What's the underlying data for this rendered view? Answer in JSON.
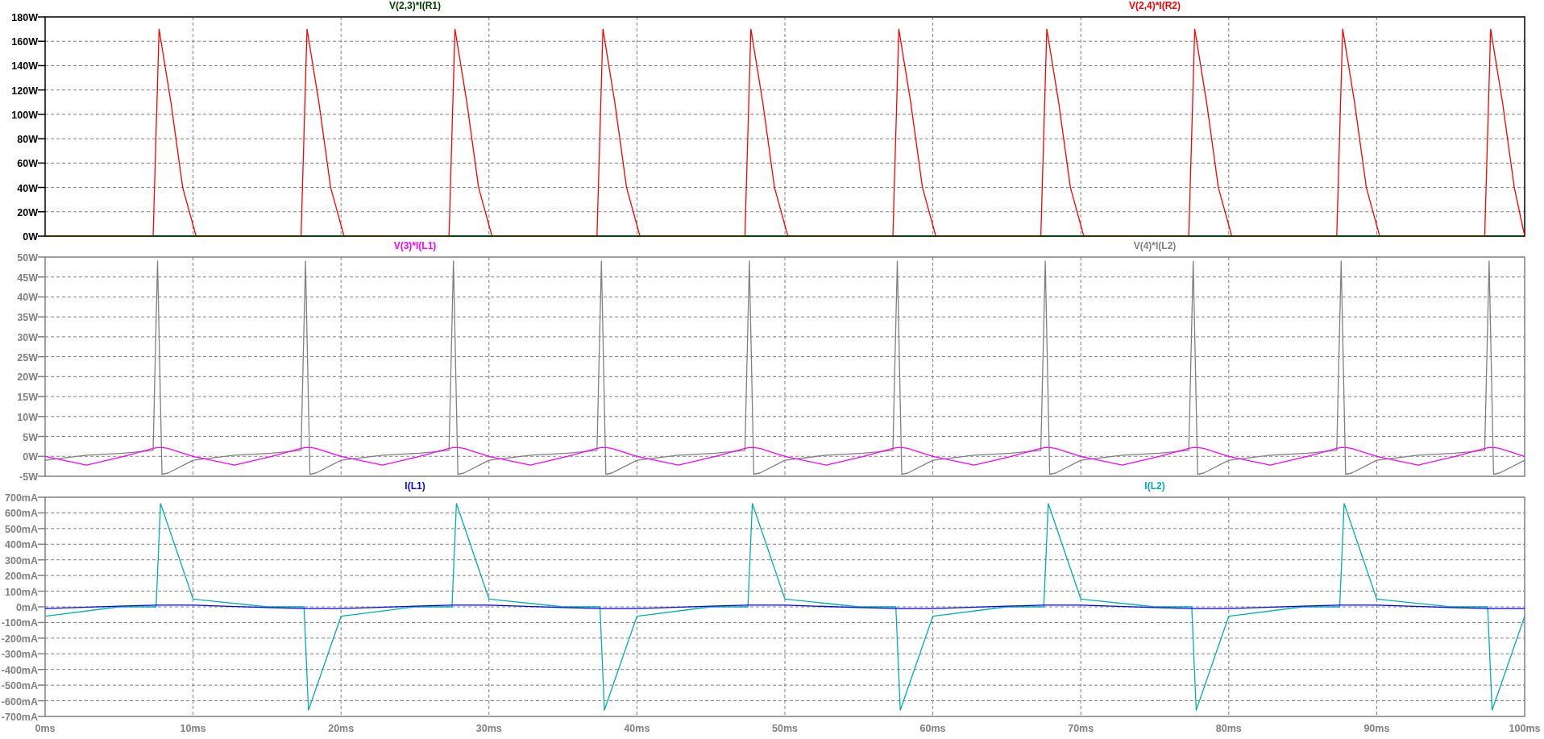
{
  "panes": [
    {
      "selected": true,
      "chart_data": {
        "type": "line",
        "xlim": [
          0,
          100
        ],
        "ylim": [
          0,
          180
        ],
        "x": [
          0,
          7.3,
          7.7,
          8.5,
          9.3,
          10.2,
          17.3,
          17.7,
          18.5,
          19.3,
          20.2,
          27.3,
          27.7,
          28.5,
          29.3,
          30.2,
          37.3,
          37.7,
          38.5,
          39.3,
          40.2,
          47.3,
          47.7,
          48.5,
          49.3,
          50.2,
          57.3,
          57.7,
          58.5,
          59.3,
          60.2,
          67.3,
          67.7,
          68.5,
          69.3,
          70.2,
          77.3,
          77.7,
          78.5,
          79.3,
          80.2,
          87.3,
          87.7,
          88.5,
          89.3,
          90.2,
          97.3,
          97.7,
          98.5,
          99.3,
          100
        ],
        "series": [
          {
            "name": "V(2,3)*I(R1)",
            "color": "#004000",
            "values": [
              0,
              0,
              0,
              0,
              0,
              0,
              0,
              0,
              0,
              0,
              0,
              0,
              0,
              0,
              0,
              0,
              0,
              0,
              0,
              0,
              0,
              0,
              0,
              0,
              0,
              0,
              0,
              0,
              0,
              0,
              0,
              0,
              0,
              0,
              0,
              0,
              0,
              0,
              0,
              0,
              0,
              0,
              0,
              0,
              0,
              0,
              0,
              0,
              0,
              0,
              0
            ]
          },
          {
            "name": "V(2,4)*I(R2)",
            "color": "#ff0000",
            "values": [
              0,
              0,
              170,
              110,
              40,
              0,
              0,
              170,
              110,
              40,
              0,
              0,
              170,
              110,
              40,
              0,
              0,
              170,
              110,
              40,
              0,
              0,
              170,
              110,
              40,
              0,
              0,
              170,
              110,
              40,
              0,
              0,
              170,
              110,
              40,
              0,
              0,
              170,
              110,
              40,
              0,
              0,
              170,
              110,
              40,
              0,
              0,
              170,
              110,
              40,
              0
            ]
          }
        ],
        "grid": true,
        "yticks": [
          {
            "value": 0,
            "label": "0W"
          },
          {
            "value": 20,
            "label": "20W"
          },
          {
            "value": 40,
            "label": "40W"
          },
          {
            "value": 60,
            "label": "60W"
          },
          {
            "value": 80,
            "label": "80W"
          },
          {
            "value": 100,
            "label": "100W"
          },
          {
            "value": 120,
            "label": "120W"
          },
          {
            "value": 140,
            "label": "140W"
          },
          {
            "value": 160,
            "label": "160W"
          },
          {
            "value": 180,
            "label": "180W"
          }
        ]
      }
    },
    {
      "selected": false,
      "chart_data": {
        "type": "line",
        "xlim": [
          0,
          100
        ],
        "ylim": [
          -5,
          50
        ],
        "x": [
          0,
          2.8,
          5.3,
          7.3,
          7.6,
          7.9,
          8.3,
          10,
          12.8,
          15.3,
          17.3,
          17.6,
          17.9,
          18.3,
          20,
          22.8,
          25.3,
          27.3,
          27.6,
          27.9,
          28.3,
          30,
          32.8,
          35.3,
          37.3,
          37.6,
          37.9,
          38.3,
          40,
          42.8,
          45.3,
          47.3,
          47.6,
          47.9,
          48.3,
          50,
          52.8,
          55.3,
          57.3,
          57.6,
          57.9,
          58.3,
          60,
          62.8,
          65.3,
          67.3,
          67.6,
          67.9,
          68.3,
          70,
          72.8,
          75.3,
          77.3,
          77.6,
          77.9,
          78.3,
          80,
          82.8,
          85.3,
          87.3,
          87.6,
          87.9,
          88.3,
          90,
          92.8,
          95.3,
          97.3,
          97.6,
          97.9,
          98.3,
          100
        ],
        "series": [
          {
            "name": "V(3)*I(L1)",
            "color": "#ff00ff",
            "values": [
              0,
              -2.2,
              0,
              2,
              2.2,
              2.2,
              2,
              0,
              -2.2,
              0,
              2,
              2.2,
              2.2,
              2,
              0,
              -2.2,
              0,
              2,
              2.2,
              2.2,
              2,
              0,
              -2.2,
              0,
              2,
              2.2,
              2.2,
              2,
              0,
              -2.2,
              0,
              2,
              2.2,
              2.2,
              2,
              0,
              -2.2,
              0,
              2,
              2.2,
              2.2,
              2,
              0,
              -2.2,
              0,
              2,
              2.2,
              2.2,
              2,
              0,
              -2.2,
              0,
              2,
              2.2,
              2.2,
              2,
              0,
              -2.2,
              0,
              2,
              2.2,
              2.2,
              2,
              0,
              -2.2,
              0,
              2,
              2.2,
              2.2,
              2,
              0
            ]
          },
          {
            "name": "V(4)*I(L2)",
            "color": "#808080",
            "values": [
              -1,
              0.3,
              0.8,
              1.5,
              49,
              -4.5,
              -4.2,
              -1,
              0.3,
              0.8,
              1.5,
              49,
              -4.5,
              -4.2,
              -1,
              0.3,
              0.8,
              1.5,
              49,
              -4.5,
              -4.2,
              -1,
              0.3,
              0.8,
              1.5,
              49,
              -4.5,
              -4.2,
              -1,
              0.3,
              0.8,
              1.5,
              49,
              -4.5,
              -4.2,
              -1,
              0.3,
              0.8,
              1.5,
              49,
              -4.5,
              -4.2,
              -1,
              0.3,
              0.8,
              1.5,
              49,
              -4.5,
              -4.2,
              -1,
              0.3,
              0.8,
              1.5,
              49,
              -4.5,
              -4.2,
              -1,
              0.3,
              0.8,
              1.5,
              49,
              -4.5,
              -4.2,
              -1,
              0.3,
              0.8,
              1.5,
              49,
              -4.5,
              -4.2,
              -1
            ]
          }
        ],
        "grid": true,
        "yticks": [
          {
            "value": -5,
            "label": "-5W"
          },
          {
            "value": 0,
            "label": "0W"
          },
          {
            "value": 5,
            "label": "5W"
          },
          {
            "value": 10,
            "label": "10W"
          },
          {
            "value": 15,
            "label": "15W"
          },
          {
            "value": 20,
            "label": "20W"
          },
          {
            "value": 25,
            "label": "25W"
          },
          {
            "value": 30,
            "label": "30W"
          },
          {
            "value": 35,
            "label": "35W"
          },
          {
            "value": 40,
            "label": "40W"
          },
          {
            "value": 45,
            "label": "45W"
          },
          {
            "value": 50,
            "label": "50W"
          }
        ]
      }
    },
    {
      "selected": false,
      "chart_data": {
        "type": "line",
        "xlim": [
          0,
          100
        ],
        "ylim": [
          -700,
          700
        ],
        "x": [
          0,
          5,
          7.5,
          7.8,
          10,
          15,
          17.5,
          17.8,
          20,
          25,
          27.5,
          27.8,
          30,
          35,
          37.5,
          37.8,
          40,
          45,
          47.5,
          47.8,
          50,
          55,
          57.5,
          57.8,
          60,
          65,
          67.5,
          67.8,
          70,
          75,
          77.5,
          77.8,
          80,
          85,
          87.5,
          87.8,
          90,
          95,
          97.5,
          97.8,
          100
        ],
        "series": [
          {
            "name": "I(L1)",
            "color": "#0000ff",
            "values": [
              -11,
              4,
              11,
              11,
              11,
              -4,
              -11,
              -11,
              -11,
              4,
              11,
              11,
              11,
              -4,
              -11,
              -11,
              -11,
              4,
              11,
              11,
              11,
              -4,
              -11,
              -11,
              -11,
              4,
              11,
              11,
              11,
              -4,
              -11,
              -11,
              -11,
              4,
              11,
              11,
              11,
              -4,
              -11,
              -11,
              -11
            ]
          },
          {
            "name": "I(L2)",
            "color": "#00b0b0",
            "values": [
              -60,
              0,
              0,
              660,
              50,
              0,
              0,
              -660,
              -60,
              0,
              0,
              660,
              50,
              0,
              0,
              -660,
              -60,
              0,
              0,
              660,
              50,
              0,
              0,
              -660,
              -60,
              0,
              0,
              660,
              50,
              0,
              0,
              -660,
              -60,
              0,
              0,
              660,
              50,
              0,
              0,
              -660,
              -60
            ]
          }
        ],
        "grid": true,
        "xticks": [
          {
            "value": 0,
            "label": "0ms"
          },
          {
            "value": 10,
            "label": "10ms"
          },
          {
            "value": 20,
            "label": "20ms"
          },
          {
            "value": 30,
            "label": "30ms"
          },
          {
            "value": 40,
            "label": "40ms"
          },
          {
            "value": 50,
            "label": "50ms"
          },
          {
            "value": 60,
            "label": "60ms"
          },
          {
            "value": 70,
            "label": "70ms"
          },
          {
            "value": 80,
            "label": "80ms"
          },
          {
            "value": 90,
            "label": "90ms"
          },
          {
            "value": 100,
            "label": "100ms"
          }
        ],
        "yticks": [
          {
            "value": -700,
            "label": "-700mA"
          },
          {
            "value": -600,
            "label": "-600mA"
          },
          {
            "value": -500,
            "label": "-500mA"
          },
          {
            "value": -400,
            "label": "-400mA"
          },
          {
            "value": -300,
            "label": "-300mA"
          },
          {
            "value": -200,
            "label": "-200mA"
          },
          {
            "value": -100,
            "label": "-100mA"
          },
          {
            "value": 0,
            "label": "0mA"
          },
          {
            "value": 100,
            "label": "100mA"
          },
          {
            "value": 200,
            "label": "200mA"
          },
          {
            "value": 300,
            "label": "300mA"
          },
          {
            "value": 400,
            "label": "400mA"
          },
          {
            "value": 500,
            "label": "500mA"
          },
          {
            "value": 600,
            "label": "600mA"
          },
          {
            "value": 700,
            "label": "700mA"
          }
        ]
      }
    }
  ]
}
